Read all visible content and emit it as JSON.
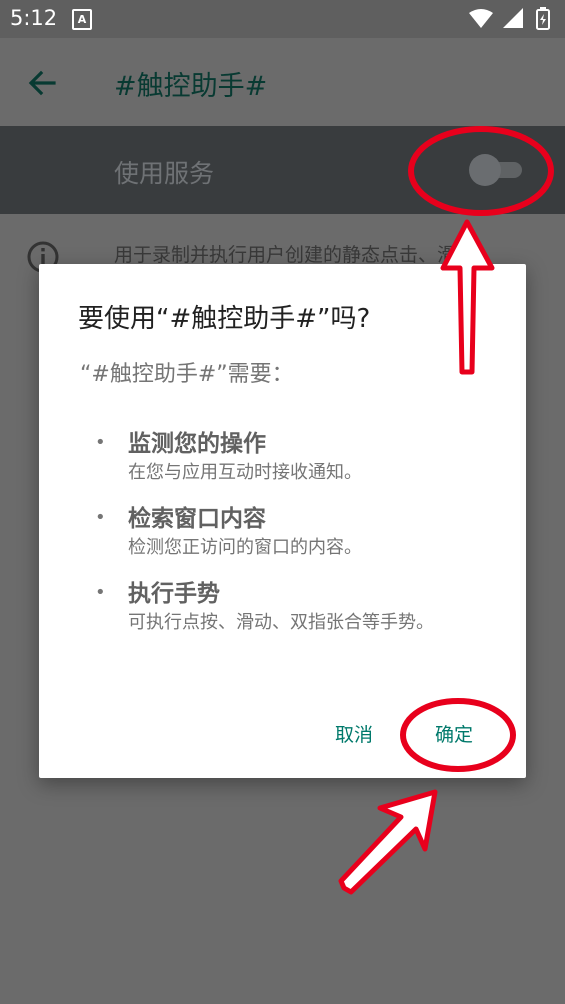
{
  "status_bar": {
    "time": "5:12",
    "notification_glyph": "A",
    "icons": [
      "wifi-icon",
      "cell-signal-icon",
      "battery-icon"
    ]
  },
  "toolbar": {
    "title": "#触控助手#",
    "back_icon": "arrow-back-icon"
  },
  "settings": {
    "service_label": "使用服务",
    "service_enabled": false,
    "description": "用于录制并执行用户创建的静态点击、滑"
  },
  "dialog": {
    "title": "要使用“#触控助手#”吗?",
    "subtitle": "“#触控助手#”需要：",
    "bullet": "•",
    "permissions": [
      {
        "title": "监测您的操作",
        "desc": "在您与应用互动时接收通知。"
      },
      {
        "title": "检索窗口内容",
        "desc": "检测您正访问的窗口的内容。"
      },
      {
        "title": "执行手势",
        "desc": "可执行点按、滑动、双指张合等手势。"
      }
    ],
    "cancel_label": "取消",
    "confirm_label": "确定"
  },
  "colors": {
    "accent": "#00796b",
    "annotation": "#e8001c",
    "scrim": "#6b6b6b",
    "dialog_bg": "#ffffff"
  }
}
